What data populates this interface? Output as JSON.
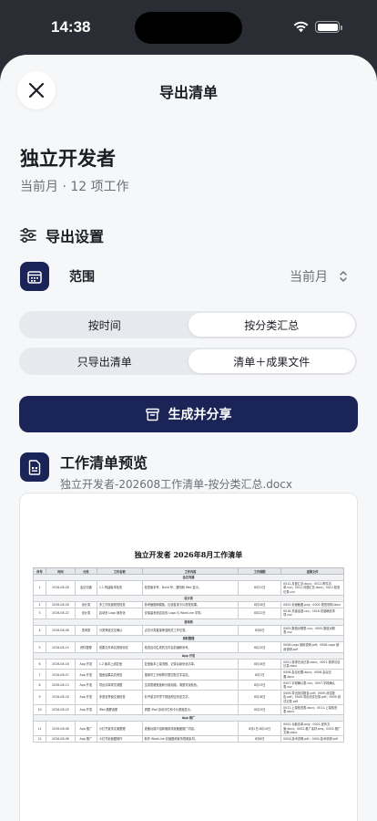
{
  "status": {
    "time": "14:38"
  },
  "sheet": {
    "title": "导出清单",
    "close_label": "关闭"
  },
  "header": {
    "title": "独立开发者",
    "subtitle": "当前月 · 12 项工作"
  },
  "settings": {
    "heading": "导出设置",
    "range_label": "范围",
    "range_value": "当前月",
    "group_segments": [
      "按时间",
      "按分类汇总"
    ],
    "group_selected": 1,
    "content_segments": [
      "只导出清单",
      "清单＋成果文件"
    ],
    "content_selected": 1
  },
  "action": {
    "generate_label": "生成并分享"
  },
  "preview": {
    "heading": "工作清单预览",
    "filename": "独立开发者-202608工作清单-按分类汇总.docx",
    "doc_title": "独立开发者 2026年8月工作清单",
    "columns": [
      "序号",
      "时间",
      "分类",
      "工作名称",
      "工作内容",
      "工作期限",
      "成果文件"
    ],
    "groups": [
      {
        "name": "会议沟通",
        "rows": [
          {
            "no": "1",
            "date": "2026-08-28",
            "cat": "会议沟通",
            "name": "1.1 构建版本检查",
            "content": "检查版本号、Build 号、通知和 iPad 显示。",
            "deadline": "8月31日",
            "files": "0012-月度汇总.docx；0012-附件清单.csv；0012-问题汇总.docx；0012-检查记录.csv"
          }
        ]
      },
      {
        "name": "设计类",
        "rows": [
          {
            "no": "2",
            "date": "2026-08-26",
            "cat": "设计类",
            "name": "多工作页面视觉检查",
            "content": "参考截图和模板，比较各类卡片视觉效果。",
            "deadline": "8月26日",
            "files": "0005-页面截图.png；0005-视觉说明.docx"
          },
          {
            "no": "3",
            "date": "2026-08-22",
            "cat": "设计类",
            "name": "启动页 Logo 静态化",
            "content": "仅保留系统启动页 Logo 与 WorkLine 字样。",
            "deadline": "8月22日",
            "files": "0016-关键话语.csv；0016-关键确信事项.csv"
          }
        ]
      },
      {
        "name": "咨询类",
        "rows": [
          {
            "no": "4",
            "date": "2026-08-08",
            "cat": "咨询类",
            "name": "分类筛选交互确认",
            "content": "点击分类直接筛选相关工作记录。",
            "deadline": "8月8日",
            "files": "0005-数值对照表.csv；0005-数值对照表.csv"
          }
        ]
      },
      {
        "name": "资料整理",
        "rows": [
          {
            "no": "5",
            "date": "2026-08-15",
            "cat": "资料整理",
            "name": "成果文件命名规则测试",
            "content": "检查自动生成的文件名前缀和序号。",
            "deadline": "8月15日",
            "files": "0008-Logo 使用说明.pdf；0008-Logo 使用说明.pdf"
          }
        ]
      },
      {
        "name": "App 开发",
        "rows": [
          {
            "no": "6",
            "date": "2026-08-16",
            "cat": "App 开发",
            "name": "1.2 版本上线复盘",
            "content": "复盘版本上架流程、记录后续优化清单。",
            "deadline": "8月16日",
            "files": "0001-需求访谈记录.docx；0001-需求访谈记录.docx"
          },
          {
            "no": "7",
            "date": "2026-08-07",
            "cat": "App 开发",
            "name": "搜索结果高亮修复",
            "content": "搜索时工作和附件里匹配文字高亮。",
            "deadline": "8月7日",
            "files": "0006-会议纪要.docx；0006-会议纪要.docx"
          },
          {
            "no": "8",
            "date": "2026-08-13",
            "cat": "App 开发",
            "name": "导出清单样式调整",
            "content": "生成表格宽度和分组标题、调整背景颜色。",
            "deadline": "8月13日",
            "files": "0007-字段确认表.csv；0007-字段确认表.csv"
          },
          {
            "no": "9",
            "date": "2026-08-18",
            "cat": "App 开发",
            "name": "多语言界面文案检查",
            "content": "补齐英文环境下按钮和空状态文字。",
            "deadline": "8月18日",
            "files": "0009-导出测试报告.pdf；0009-测试报告.pdf；0009-导出测试记录.pdf；0009-测试记录.pdf"
          },
          {
            "no": "10",
            "date": "2026-08-25",
            "cat": "App 开发",
            "name": "iPad 横屏适配",
            "content": "调整 iPad 自动分栏和卡片宽度显示。",
            "deadline": "8月25日",
            "files": "0011-上架检查表.docx；0011-上架检查表.docx"
          }
        ]
      },
      {
        "name": "App 推广",
        "rows": [
          {
            "no": "11",
            "date": "2026-08-06",
            "cat": "App 推广",
            "name": "小红书宣传文案整理",
            "content": "准备功能介绍和使用场景截图推广内容。",
            "deadline": "8月2日-8月10日",
            "files": "0002-功能清单.png；0002-宣传文案.docx；0002-推广素材.png；0002-推广文案.docx"
          },
          {
            "no": "12",
            "date": "2026-08-08",
            "cat": "App 推广",
            "name": "小红书封面图制作",
            "content": "制作 WorkLine 封面图和宣传视频素材。",
            "deadline": "8月8日",
            "files": "0004-技术说明.pdf；0004-技术说明.pdf"
          }
        ]
      }
    ]
  }
}
